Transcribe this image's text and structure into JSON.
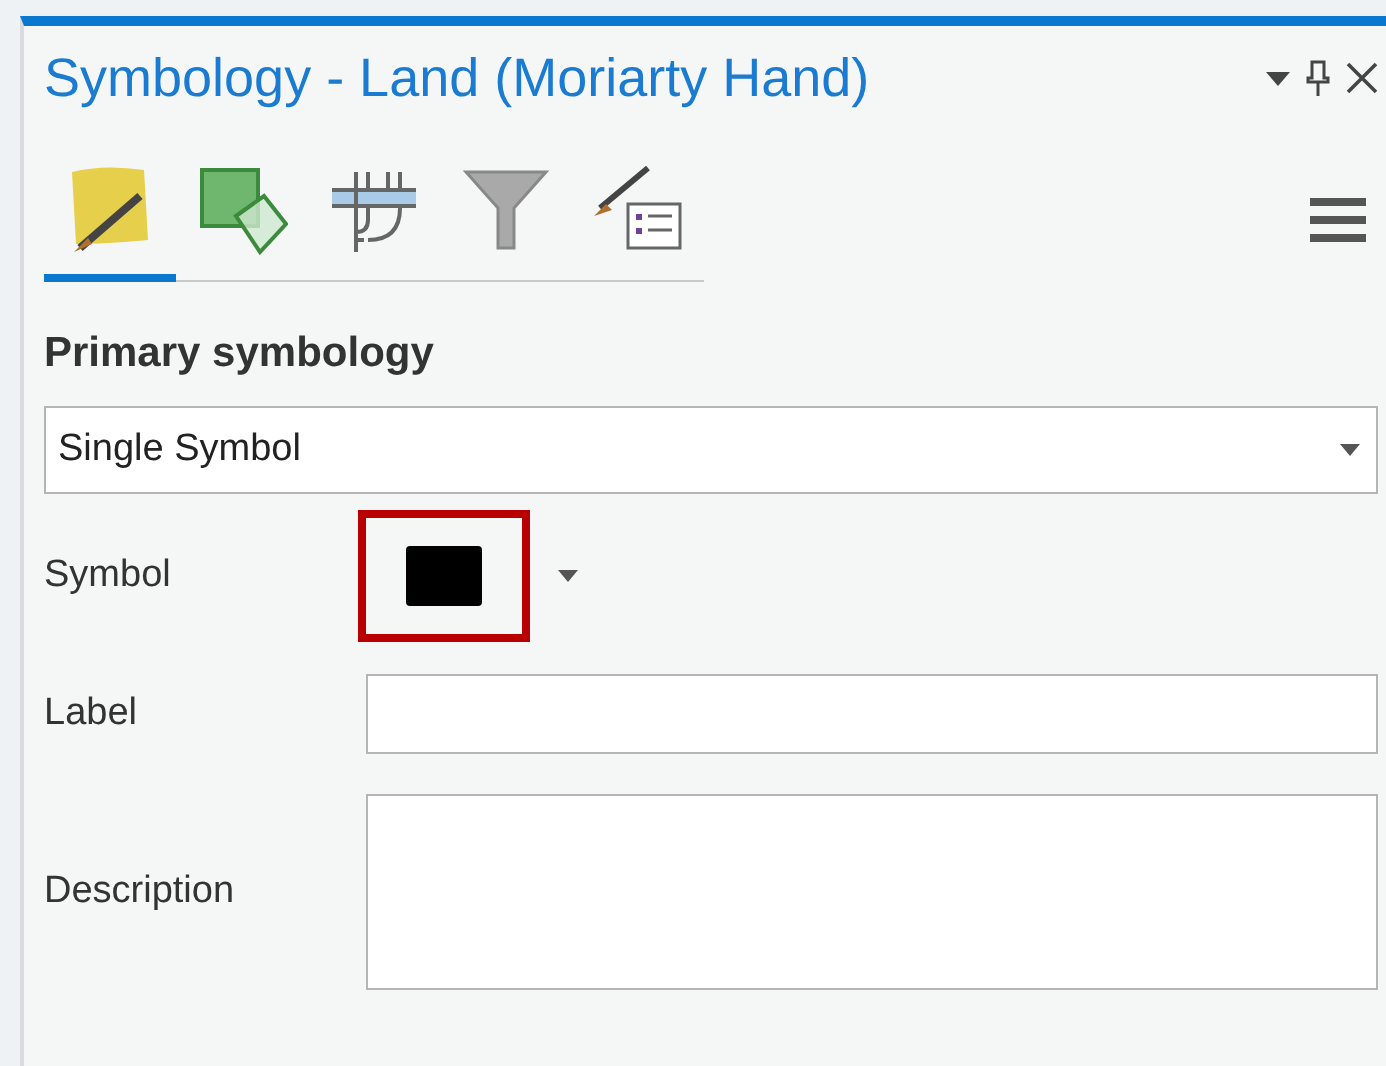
{
  "pane": {
    "title": "Symbology - Land (Moriarty Hand)"
  },
  "tabs": [
    {
      "kind": "primary",
      "selected": true
    },
    {
      "kind": "vary",
      "selected": false
    },
    {
      "kind": "scale",
      "selected": false
    },
    {
      "kind": "filter",
      "selected": false
    },
    {
      "kind": "legend",
      "selected": false
    }
  ],
  "section": {
    "heading": "Primary symbology"
  },
  "renderer": {
    "value": "Single Symbol"
  },
  "symbol": {
    "label": "Symbol",
    "highlighted": true
  },
  "fields": [
    {
      "label": "Label",
      "kind": "line"
    },
    {
      "label": "Description",
      "kind": "area"
    }
  ]
}
